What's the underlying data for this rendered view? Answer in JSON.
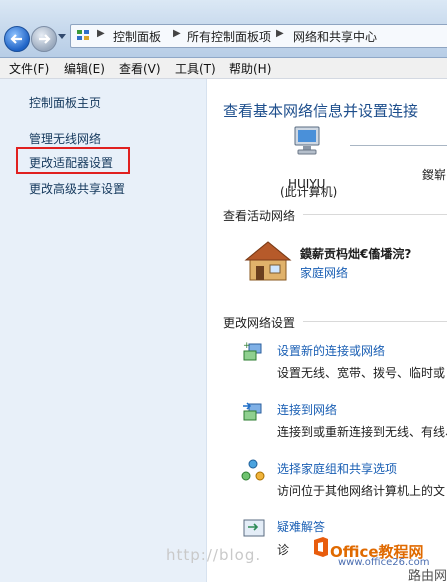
{
  "breadcrumb": [
    "控制面板",
    "所有控制面板项",
    "网络和共享中心"
  ],
  "menu": [
    "文件(F)",
    "编辑(E)",
    "查看(V)",
    "工具(T)",
    "帮助(H)"
  ],
  "left_nav": {
    "home": "控制面板主页",
    "wireless": "管理无线网络",
    "adapter": "更改适配器设置",
    "sharing": "更改高级共享设置"
  },
  "main": {
    "heading": "查看基本网络信息并设置连接",
    "computer_name": "HUIYU",
    "computer_sub": "(此计算机)",
    "truncated_node": "鍐崭",
    "active_title": "查看活动网络",
    "network_name": "鏌薪贡杩炪€傗墦浣?",
    "network_type": "家庭网络",
    "change_title": "更改网络设置",
    "tasks": [
      {
        "link": "设置新的连接或网络",
        "desc": "设置无线、宽带、拨号、临时或"
      },
      {
        "link": "连接到网络",
        "desc": "连接到或重新连接到无线、有线、"
      },
      {
        "link": "选择家庭组和共享选项",
        "desc": "访问位于其他网络计算机上的文"
      },
      {
        "link": "疑难解答",
        "desc": "诊"
      }
    ]
  },
  "watermark": {
    "blog": "http://blog.",
    "brand": "Office教程网",
    "site": "www.office26.com",
    "corner": "路由网"
  }
}
